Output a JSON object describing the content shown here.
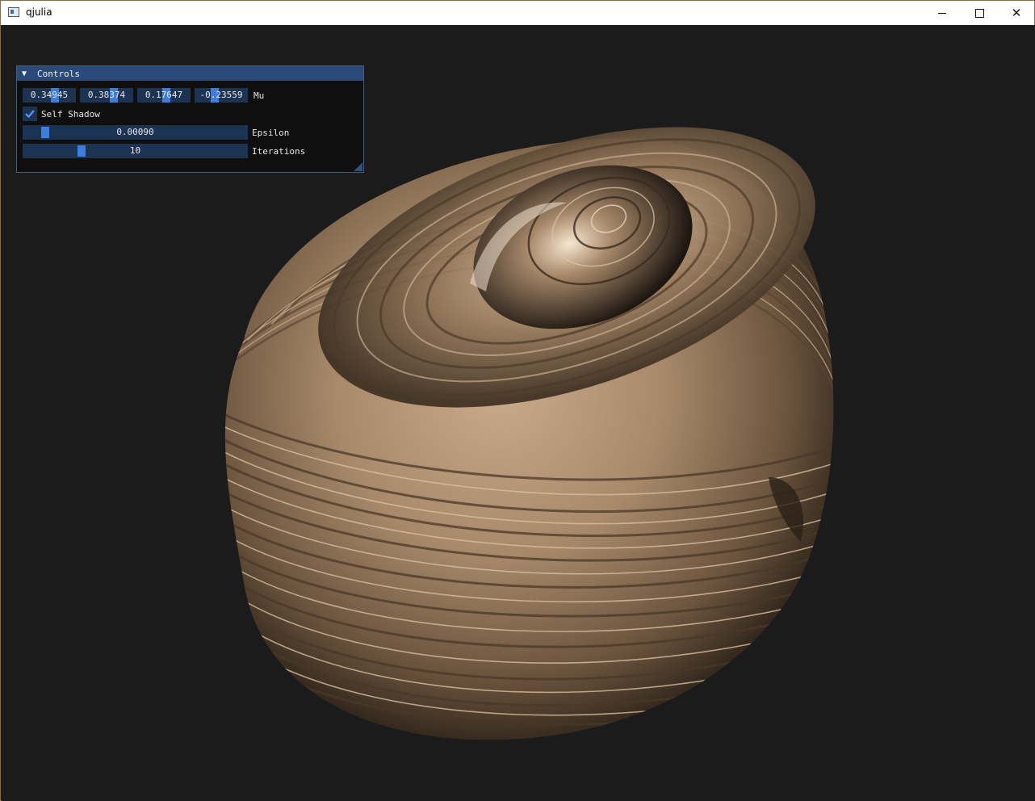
{
  "window": {
    "title": "qjulia",
    "accent": "#294a7a"
  },
  "controls": {
    "header": "Controls",
    "mu": {
      "values": [
        "0.34945",
        "0.38374",
        "0.17647",
        "-0.23559"
      ],
      "label": "Mu"
    },
    "self_shadow": {
      "label": "Self Shadow",
      "checked": true
    },
    "epsilon": {
      "value": "0.00090",
      "label": "Epsilon"
    },
    "iterations": {
      "value": "10",
      "label": "Iterations"
    }
  },
  "icons": {
    "collapse": "triangle-down-icon",
    "check": "checkmark-icon",
    "minimize": "minimize-icon",
    "maximize": "maximize-icon",
    "close": "close-icon"
  }
}
